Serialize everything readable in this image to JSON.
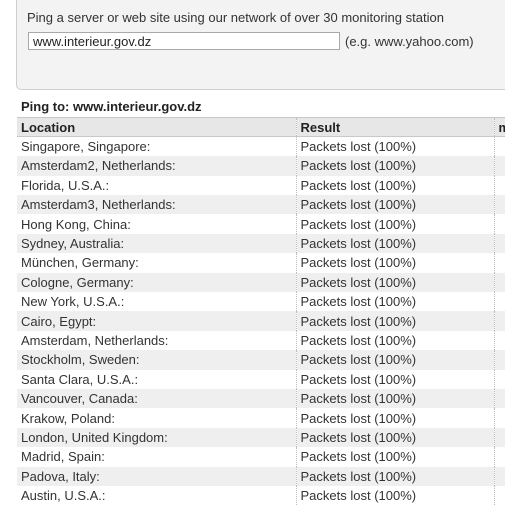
{
  "form": {
    "intro": "Ping a server or web site using our network of over 30 monitoring station",
    "url_value": "www.interieur.gov.dz",
    "example": "(e.g. www.yahoo.com)"
  },
  "results": {
    "heading": "Ping to: www.interieur.gov.dz",
    "columns": [
      "Location",
      "Result",
      "m"
    ],
    "rows": [
      {
        "location": "Singapore, Singapore:",
        "result": "Packets lost (100%)"
      },
      {
        "location": "Amsterdam2, Netherlands:",
        "result": "Packets lost (100%)"
      },
      {
        "location": "Florida, U.S.A.:",
        "result": "Packets lost (100%)"
      },
      {
        "location": "Amsterdam3, Netherlands:",
        "result": "Packets lost (100%)"
      },
      {
        "location": "Hong Kong, China:",
        "result": "Packets lost (100%)"
      },
      {
        "location": "Sydney, Australia:",
        "result": "Packets lost (100%)"
      },
      {
        "location": "München, Germany:",
        "result": "Packets lost (100%)"
      },
      {
        "location": "Cologne, Germany:",
        "result": "Packets lost (100%)"
      },
      {
        "location": "New York, U.S.A.:",
        "result": "Packets lost (100%)"
      },
      {
        "location": "Cairo, Egypt:",
        "result": "Packets lost (100%)"
      },
      {
        "location": "Amsterdam, Netherlands:",
        "result": "Packets lost (100%)"
      },
      {
        "location": "Stockholm, Sweden:",
        "result": "Packets lost (100%)"
      },
      {
        "location": "Santa Clara, U.S.A.:",
        "result": "Packets lost (100%)"
      },
      {
        "location": "Vancouver, Canada:",
        "result": "Packets lost (100%)"
      },
      {
        "location": "Krakow, Poland:",
        "result": "Packets lost (100%)"
      },
      {
        "location": "London, United Kingdom:",
        "result": "Packets lost (100%)"
      },
      {
        "location": "Madrid, Spain:",
        "result": "Packets lost (100%)"
      },
      {
        "location": "Padova, Italy:",
        "result": "Packets lost (100%)"
      },
      {
        "location": "Austin, U.S.A.:",
        "result": "Packets lost (100%)"
      }
    ]
  }
}
